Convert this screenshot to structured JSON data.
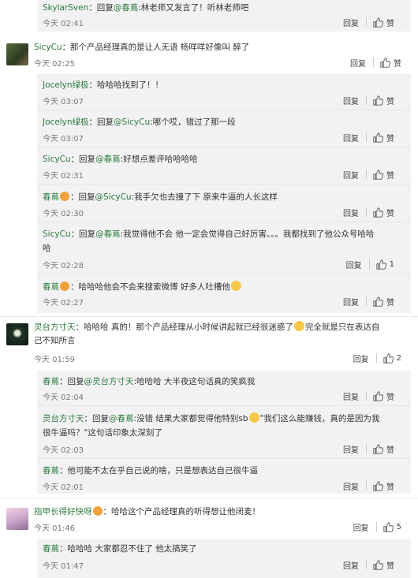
{
  "labels": {
    "reply": "回复",
    "like": "赞",
    "reply_prefix": "：回复"
  },
  "c0": {
    "user": "SkylarSven",
    "at": "@春蔦",
    "text": ":林老师又发言了！听林老师吧",
    "time": "今天 02:41"
  },
  "c1": {
    "user": "SicyCu",
    "text": "：那个产品经理真的是让人无语 杨咩咩好像叫 醉了",
    "time": "今天 02:25"
  },
  "r1": {
    "user": "Jocelyn绿极",
    "text": "：哈哈哈找到了！！",
    "time": "今天 03:07"
  },
  "r2": {
    "user": "Jocelyn绿极",
    "at": "@SicyCu",
    "text": ":哪个哎，错过了那一段",
    "time": "今天 03:07"
  },
  "r3": {
    "user": "SicyCu",
    "at": "@春蔦",
    "text": ":好想点差评哈哈哈哈",
    "time": "今天 02:31"
  },
  "r4": {
    "user": "春蔦",
    "at": "@SicyCu",
    "text": ":我手欠也去撞了下 原来牛逼的人长这样",
    "time": "今天 02:30"
  },
  "r5": {
    "user": "SicyCu",
    "at": "@春蔦",
    "text_a": ":我觉得他不会 他一定会觉得自己好厉害。。。我都找到了他公众号哈哈",
    "text_b": "哈",
    "time": "今天 02:28",
    "likes": "1"
  },
  "r6": {
    "user": "春蔦",
    "text": "：哈哈哈他会不会来搜索微博 好多人吐槽他",
    "time": "今天 02:27"
  },
  "c2": {
    "user": "灵台方寸天",
    "text_a": "：哈哈哈 真的！那个产品经理从小时候讲起就已经很迷惑了",
    "text_a2": "完全就是只在表达自",
    "text_b": "己不知所言",
    "time": "今天 01:59",
    "likes": "2"
  },
  "r7": {
    "user": "春蔦",
    "at": "@灵台方寸天",
    "text": ":哈哈哈 大半夜这句话真的笑疯我",
    "time": "今天 02:04"
  },
  "r8": {
    "user": "灵台方寸天",
    "at": "@春蔦",
    "text_a": ":没错 结果大家都觉得他特别sb",
    "text_a2": "\"我们这么能赚钱，真的是因为我",
    "text_b": "很牛逼吗？\"这句话印象太深刻了",
    "time": "今天 02:03"
  },
  "r9": {
    "user": "春蔦",
    "text": "：他可能不太在乎自己说的啥，只是想表达自己很牛逼",
    "time": "今天 02:01"
  },
  "c3": {
    "user": "指甲长得好快呀",
    "text": "：哈哈这个产品经理真的听得想让他闭麦！",
    "time": "今天 01:46",
    "likes": "5"
  },
  "r10": {
    "user": "春蔦",
    "text": "：哈哈哈 大家都忍不住了 他太搞笑了",
    "time": "今天 01:47"
  }
}
